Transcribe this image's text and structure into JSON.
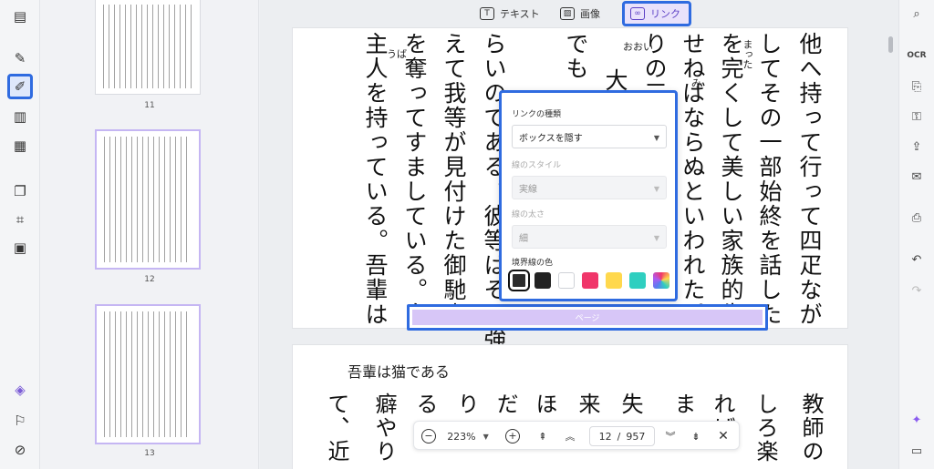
{
  "toolbar": {
    "modes": [
      {
        "label": "テキスト",
        "icon": "text-box-icon",
        "glyph": "T"
      },
      {
        "label": "画像",
        "icon": "image-icon",
        "glyph": "▨"
      },
      {
        "label": "リンク",
        "icon": "link-icon",
        "glyph": "∞",
        "active": true
      }
    ]
  },
  "thumbnails": [
    {
      "page": "11"
    },
    {
      "page": "12"
    },
    {
      "page": "13"
    }
  ],
  "page_top": {
    "columns": [
      "他へ持って行って四疋なが",
      "してその一部始終を話した",
      "を完くして美しい家族的生",
      "せねばならぬといわれた。",
      "りの三",
      "大に",
      "でも一",
      "えて我等が見付けた御馳走",
      "を奪ってすましている。白",
      "主人を持っている。吾輩は"
    ],
    "extra_columns": [
      "らいのである。彼等はその強力を"
    ],
    "furigana": [
      "まった",
      "おおい",
      "み",
      "うば"
    ]
  },
  "page_bottom": {
    "title": "吾輩は猫である",
    "columns": [
      "教師の",
      "しろ楽",
      "れば",
      "ま",
      "失",
      "来",
      "ほ",
      "だ",
      "り",
      "る",
      "癖やり",
      "て、近"
    ]
  },
  "popup": {
    "link_type_label": "リンクの種類",
    "link_type_value": "ボックスを隠す",
    "line_style_label": "線のスタイル",
    "line_style_value": "実線",
    "line_width_label": "線の太さ",
    "line_width_value": "細",
    "border_color_label": "境界線の色",
    "swatches": [
      "#2b2b2b",
      "#222222",
      "#ffffff",
      "#f0366a",
      "#ffd84d",
      "#2fcfc0",
      "rainbow"
    ]
  },
  "link_box": {
    "label": "ページ"
  },
  "bottom_bar": {
    "zoom": "223%",
    "page_current": "12",
    "page_separator": "/",
    "page_total": "957"
  },
  "colors": {
    "accent": "#2f6be0",
    "link_highlight": "#d7c6f7"
  }
}
